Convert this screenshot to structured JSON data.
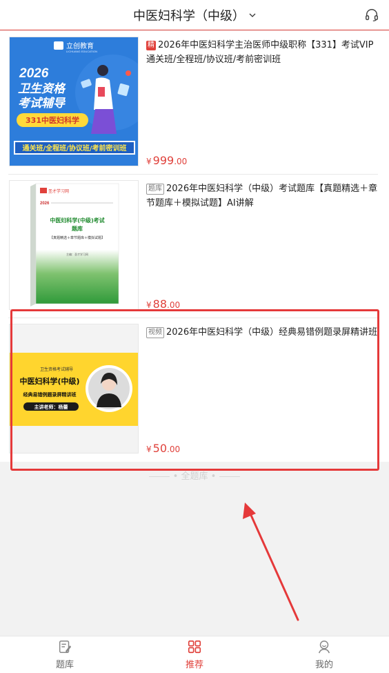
{
  "header": {
    "title": "中医妇科学（中级）"
  },
  "products": [
    {
      "tag": "精",
      "tag_style": "red",
      "title": "2026年中医妇科学主治医师中级职称【331】考试VIP通关班/全程班/协议班/考前密训班",
      "price_symbol": "¥",
      "price_int": "999",
      "price_dec": ".00",
      "thumb": {
        "brand": "立创教育",
        "brand_sub": "LICHUANG EDUCATION",
        "line1": "2026",
        "line2": "卫生资格",
        "line3": "考试辅导",
        "badge": "331中医妇科学",
        "bottom": "通关班/全程班/协议班/考前密训班"
      }
    },
    {
      "tag": "题库",
      "tag_style": "grey",
      "title": "2026年中医妇科学（中级）考试题库【真题精选＋章节题库＋模拟试题】AI讲解",
      "price_symbol": "¥",
      "price_int": "88",
      "price_dec": ".00",
      "thumb": {
        "brand": "圣才学习网",
        "top": "2026",
        "main1": "中医妇科学(中级)考试",
        "main2": "题库",
        "sub": "【真题精选＋章节题库＋模拟试题】",
        "foot": "主编：圣才学习网"
      }
    },
    {
      "tag": "视频",
      "tag_style": "grey",
      "title": "2026年中医妇科学（中级）经典易错例题录屏精讲班",
      "price_symbol": "¥",
      "price_int": "50",
      "price_dec": ".00",
      "thumb": {
        "small": "卫生资格考试辅导",
        "main": "中医妇科学(中级)",
        "sub": "经典易错例题录屏精讲班",
        "teacher": "主讲老师：杨蕾"
      }
    }
  ],
  "footer_hint": "全题库",
  "tabs": [
    {
      "label": "题库"
    },
    {
      "label": "推荐"
    },
    {
      "label": "我的"
    }
  ],
  "colors": {
    "accent": "#e0413b",
    "annotation": "#e5393a"
  }
}
